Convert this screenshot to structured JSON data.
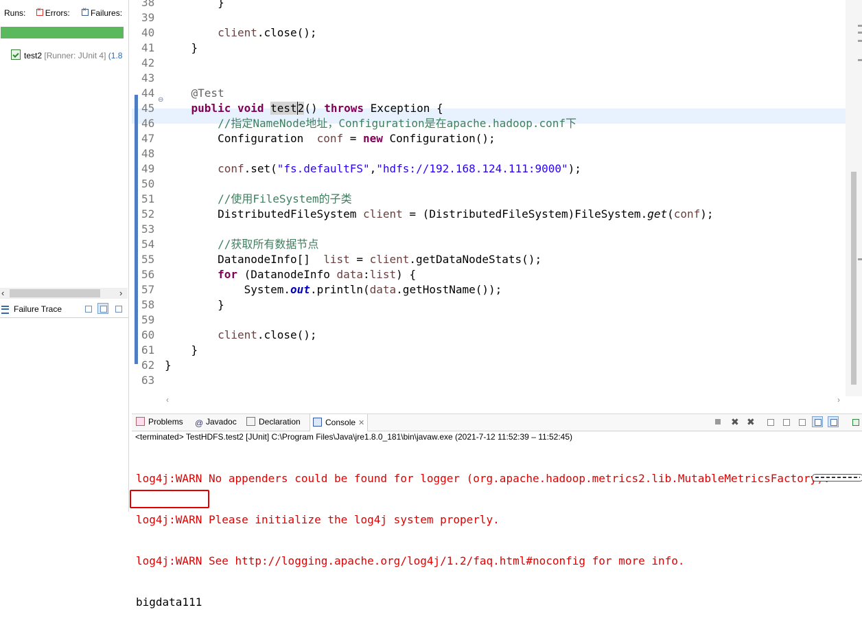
{
  "junit": {
    "runs_label": "Runs:",
    "errors_label": "Errors:",
    "failures_label": "Failures:",
    "bar_color": "#5cb85c",
    "test_name": "test2",
    "runner": "[Runner: JUnit 4]",
    "jre": "(1.8",
    "failure_trace_label": "Failure Trace"
  },
  "editor": {
    "lines": [
      {
        "n": "38",
        "code": "        }"
      },
      {
        "n": "39",
        "code": ""
      },
      {
        "n": "40",
        "code": "        client.close();"
      },
      {
        "n": "41",
        "code": "    }"
      },
      {
        "n": "42",
        "code": ""
      },
      {
        "n": "43",
        "code": ""
      },
      {
        "n": "44",
        "code": "    @Test"
      },
      {
        "n": "45",
        "code": "    public void test2() throws Exception {"
      },
      {
        "n": "46",
        "code": "        //指定NameNode地址，Configuration是在apache.hadoop.conf下"
      },
      {
        "n": "47",
        "code": "        Configuration  conf = new Configuration();"
      },
      {
        "n": "48",
        "code": ""
      },
      {
        "n": "49",
        "code": "        conf.set(\"fs.defaultFS\",\"hdfs://192.168.124.111:9000\");"
      },
      {
        "n": "50",
        "code": ""
      },
      {
        "n": "51",
        "code": "        //使用FileSystem的子类"
      },
      {
        "n": "52",
        "code": "        DistributedFileSystem client = (DistributedFileSystem)FileSystem.get(conf);"
      },
      {
        "n": "53",
        "code": ""
      },
      {
        "n": "54",
        "code": "        //获取所有数据节点"
      },
      {
        "n": "55",
        "code": "        DatanodeInfo[]  list = client.getDataNodeStats();"
      },
      {
        "n": "56",
        "code": "        for (DatanodeInfo data:list) {"
      },
      {
        "n": "57",
        "code": "            System.out.println(data.getHostName());"
      },
      {
        "n": "58",
        "code": "        }"
      },
      {
        "n": "59",
        "code": ""
      },
      {
        "n": "60",
        "code": "        client.close();"
      },
      {
        "n": "61",
        "code": "    }"
      },
      {
        "n": "62",
        "code": "}"
      },
      {
        "n": "63",
        "code": ""
      }
    ],
    "highlighted_line": "45"
  },
  "console": {
    "tabs": [
      {
        "label": "Problems",
        "icon": "problems-icon"
      },
      {
        "label": "Javadoc",
        "icon": "javadoc-icon"
      },
      {
        "label": "Declaration",
        "icon": "declaration-icon"
      },
      {
        "label": "Console",
        "icon": "console-icon"
      }
    ],
    "active_tab": "Console",
    "terminated": "<terminated> TestHDFS.test2 [JUnit] C:\\Program Files\\Java\\jre1.8.0_181\\bin\\javaw.exe  (2021-7-12 11:52:39 – 11:52:45)",
    "warnings": [
      "log4j:WARN No appenders could be found for logger (org.apache.hadoop.metrics2.lib.MutableMetricsFactory).",
      "log4j:WARN Please initialize the log4j system properly.",
      "log4j:WARN See http://logging.apache.org/log4j/1.2/faq.html#noconfig for more info."
    ],
    "output": "bigdata111",
    "warn_color": "#e00000"
  }
}
